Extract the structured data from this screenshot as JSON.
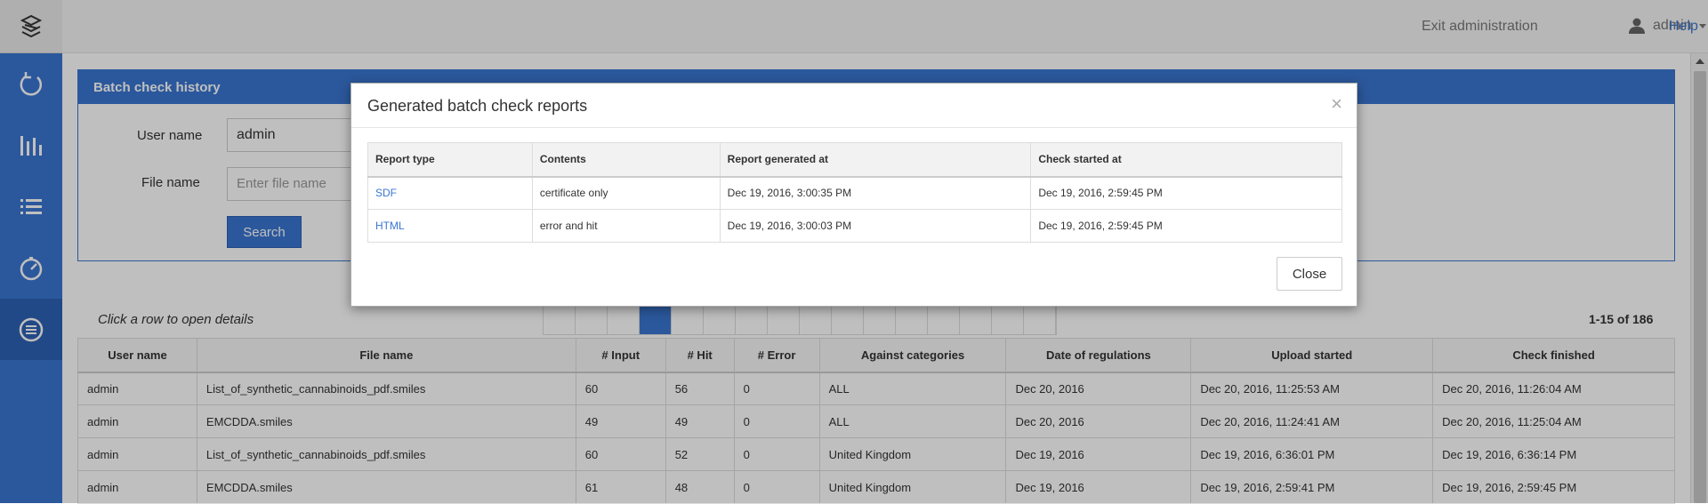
{
  "topbar": {
    "exit_label": "Exit administration",
    "user_label": "admin",
    "help_label": "Help"
  },
  "sidebar": {
    "items": [
      {
        "icon": "refresh-icon"
      },
      {
        "icon": "bar-chart-icon"
      },
      {
        "icon": "list-icon"
      },
      {
        "icon": "gauge-icon"
      },
      {
        "icon": "batch-history-icon"
      }
    ]
  },
  "panel": {
    "title": "Batch check history",
    "user_label": "User name",
    "user_value": "admin",
    "file_label": "File name",
    "file_placeholder": "Enter file name",
    "search_label": "Search"
  },
  "list": {
    "hint": "Click a row to open details",
    "count": "1-15 of 186"
  },
  "table": {
    "headers": [
      "User name",
      "File name",
      "# Input",
      "# Hit",
      "# Error",
      "Against categories",
      "Date of regulations",
      "Upload started",
      "Check finished"
    ],
    "rows": [
      [
        "admin",
        "List_of_synthetic_cannabinoids_pdf.smiles",
        "60",
        "56",
        "0",
        "ALL",
        "Dec 20, 2016",
        "Dec 20, 2016, 11:25:53 AM",
        "Dec 20, 2016, 11:26:04 AM"
      ],
      [
        "admin",
        "EMCDDA.smiles",
        "49",
        "49",
        "0",
        "ALL",
        "Dec 20, 2016",
        "Dec 20, 2016, 11:24:41 AM",
        "Dec 20, 2016, 11:25:04 AM"
      ],
      [
        "admin",
        "List_of_synthetic_cannabinoids_pdf.smiles",
        "60",
        "52",
        "0",
        "United Kingdom",
        "Dec 19, 2016",
        "Dec 19, 2016, 6:36:01 PM",
        "Dec 19, 2016, 6:36:14 PM"
      ],
      [
        "admin",
        "EMCDDA.smiles",
        "61",
        "48",
        "0",
        "United Kingdom",
        "Dec 19, 2016",
        "Dec 19, 2016, 2:59:41 PM",
        "Dec 19, 2016, 2:59:45 PM"
      ]
    ]
  },
  "modal": {
    "title": "Generated batch check reports",
    "close_symbol": "×",
    "close_label": "Close",
    "headers": [
      "Report type",
      "Contents",
      "Report generated at",
      "Check started at"
    ],
    "rows": [
      [
        "SDF",
        "certificate only",
        "Dec 19, 2016, 3:00:35 PM",
        "Dec 19, 2016, 2:59:45 PM"
      ],
      [
        "HTML",
        "error and hit",
        "Dec 19, 2016, 3:00:03 PM",
        "Dec 19, 2016, 2:59:45 PM"
      ]
    ]
  }
}
